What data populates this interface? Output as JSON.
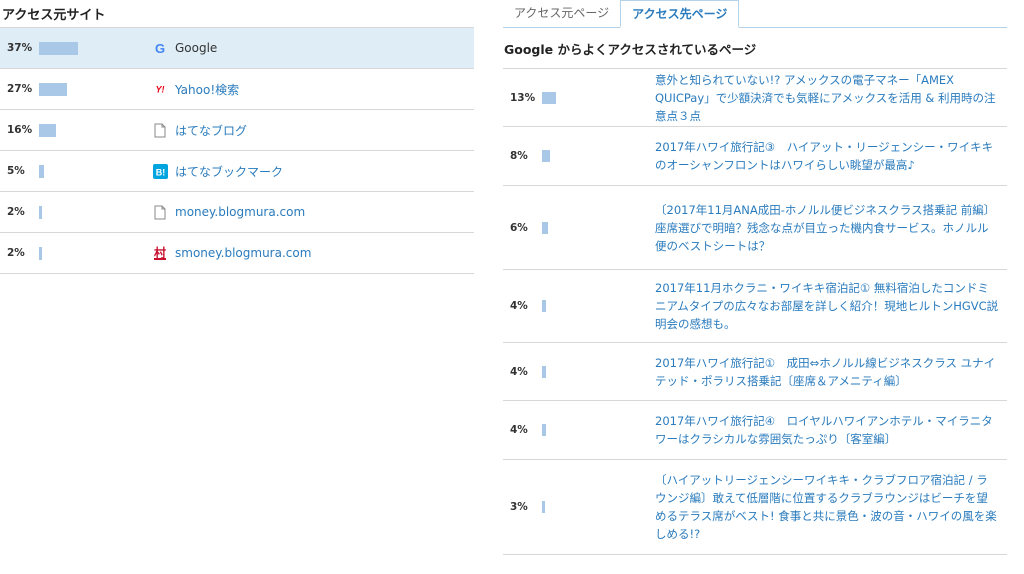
{
  "left": {
    "title": "アクセス元サイト",
    "sites": [
      {
        "pct": "37%",
        "value": 37,
        "name": "Google",
        "icon": "google-icon"
      },
      {
        "pct": "27%",
        "value": 27,
        "name": "Yahoo!検索",
        "icon": "yahoo-icon"
      },
      {
        "pct": "16%",
        "value": 16,
        "name": "はてなブログ",
        "icon": "page-icon"
      },
      {
        "pct": "5%",
        "value": 5,
        "name": "はてなブックマーク",
        "icon": "hatena-bookmark-icon"
      },
      {
        "pct": "2%",
        "value": 2,
        "name": "money.blogmura.com",
        "icon": "page-icon"
      },
      {
        "pct": "2%",
        "value": 2,
        "name": "smoney.blogmura.com",
        "icon": "blogmura-icon"
      }
    ]
  },
  "right": {
    "tabs": [
      {
        "label": "アクセス元ページ",
        "active": false
      },
      {
        "label": "アクセス先ページ",
        "active": true
      }
    ],
    "subtitle": "Google からよくアクセスされているページ",
    "pages": [
      {
        "pct": "13%",
        "value": 13,
        "title": "意外と知られていない!? アメックスの電子マネー「AMEX QUICPay」で少額決済でも気軽にアメックスを活用 & 利用時の注意点３点"
      },
      {
        "pct": "8%",
        "value": 8,
        "title": "2017年ハワイ旅行記③　ハイアット・リージェンシー・ワイキキのオーシャンフロントはハワイらしい眺望が最高♪"
      },
      {
        "pct": "6%",
        "value": 6,
        "title": "〔2017年11月ANA成田-ホノルル便ビジネスクラス搭乗記 前編〕 座席選びで明暗？残念な点が目立った機内食サービス。ホノルル便のベストシートは？"
      },
      {
        "pct": "4%",
        "value": 4,
        "title": "2017年11月ホクラニ・ワイキキ宿泊記① 無料宿泊したコンドミニアムタイプの広々なお部屋を詳しく紹介！現地ヒルトンHGVC説明会の感想も。"
      },
      {
        "pct": "4%",
        "value": 4,
        "title": "2017年ハワイ旅行記①　成田⇔ホノルル線ビジネスクラス ユナイテッド・ポラリス搭乗記〔座席＆アメニティ編〕"
      },
      {
        "pct": "4%",
        "value": 4,
        "title": "2017年ハワイ旅行記④　ロイヤルハワイアンホテル・マイラニタワーはクラシカルな雰囲気たっぷり〔客室編〕"
      },
      {
        "pct": "3%",
        "value": 3,
        "title": "〔ハイアットリージェンシーワイキキ・クラブフロア宿泊記 / ラウンジ編〕敢えて低層階に位置するクラブラウンジはビーチを望めるテラス席がベスト! 食事と共に景色・波の音・ハワイの風を楽しめる!?"
      }
    ]
  },
  "colors": {
    "bar": "#a9c8e8",
    "link": "#2a7bbd",
    "selected_row": "#deedf6"
  }
}
